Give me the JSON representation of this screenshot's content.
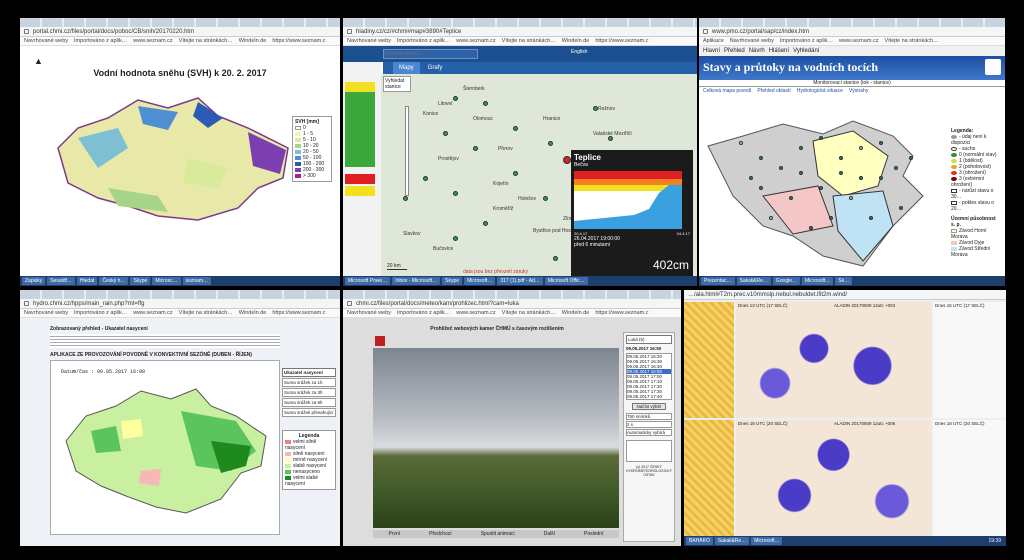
{
  "panels": [
    {
      "url": "portal.chmi.cz/files/portal/docs/poboc/CB/snih/20170220.htm",
      "bookmarks": [
        "Navrhované weby",
        "Importováno z aplik…",
        "www.seznam.cz",
        "Vítejte na stránkách…",
        "Windeln.de",
        "https://www.seznam.c"
      ],
      "title": "Vodní hodnota sněhu (SVH) k 20. 2. 2017",
      "legend_title": "SVH [mm]",
      "legend": [
        "0",
        "1 - 5",
        "5 - 10",
        "10 - 20",
        "20 - 50",
        "50 - 100",
        "100 - 200",
        "200 - 300",
        "> 300"
      ],
      "legend_colors": [
        "#ffffff",
        "#f6f2b0",
        "#d9eb9a",
        "#a8d489",
        "#7fbfd4",
        "#4d8fd0",
        "#2c5bb5",
        "#7b3fb0",
        "#b01f8f"
      ],
      "taskbar": [
        "Zapisky",
        "Sesaldf…",
        "Hledat",
        "Český h…",
        "Skype",
        "Microsc…",
        "seznam…"
      ]
    },
    {
      "url": "hladiny.cz/cz/#chmi#map#3890#Teplice",
      "bookmarks": [
        "Navrhované weby",
        "Importováno z aplik…",
        "www.seznam.cz",
        "Vítejte na stránkách…",
        "Windeln.de",
        "https://www.seznam.c"
      ],
      "search_placeholder": "Vyhledat stanici…",
      "english": "English",
      "tabs": [
        "Mapy",
        "Grafy"
      ],
      "stanice": "Vyhledat stanice",
      "places": [
        "Šternberk",
        "Olomouc",
        "Prostějov",
        "Přerov",
        "Kojetín",
        "Kroměříž",
        "Vsetín",
        "Holešov",
        "Bystřice pod Hostýnem",
        "Zlín",
        "Fryšták",
        "Luhačovice",
        "Bučovice",
        "Slavkov",
        "Konice",
        "Litovel",
        "Hranice",
        "Frenštát pod Radhoštěm",
        "Valašské Meziříčí",
        "Rožnov"
      ],
      "popup_station": "Teplice",
      "popup_river": "Bečva",
      "popup_date": "26.04.2017 19:00:00",
      "popup_age": "před 6 minutami",
      "popup_value": "402cm",
      "popup_dates": [
        "20.4.17",
        "24.4.17"
      ],
      "scale": "20 km",
      "footer": "data jsou bez převzetí záruky",
      "taskbar": [
        "Microsoft Powe…",
        "Inbox - Microsoft…",
        "Skype",
        "Microsoft…",
        "317 (1).pdf - Ad…",
        "Microsoft Offic…"
      ]
    },
    {
      "url": "www.pmo.cz/portal/sap/cz/index.htm",
      "bookmarks": [
        "Aplikace",
        "Navrhované weby",
        "Importováno z aplik…",
        "www.seznam.cz",
        "Vítejte na stránkách…"
      ],
      "title": "Stavy a průtoky na vodních tocích",
      "subtitle": "Monitorovací stanice (tok - stanice)",
      "nav": [
        "Celková mapa povodí",
        "Přehled oblastí",
        "Hydrologická situace",
        "Výstrahy"
      ],
      "nav2": [
        "Hlavní",
        "Přehled",
        "Návrh",
        "Hlášení",
        "Vyhledání"
      ],
      "legend_title": "Legenda:",
      "legend": [
        "- údaj není k dispozici",
        "- sucho",
        "0 (normální stav)",
        "1 (bdělost)",
        "2 (pohotovost)",
        "3 (ohrožení)",
        "3 (extrémní ohrožení)",
        "- nárůst stavu o 30…",
        "- pokles stavu o 20…"
      ],
      "legend_colors": [
        "#999999",
        "#ffffff",
        "#2e8b2e",
        "#c8e04a",
        "#f0a020",
        "#e03020",
        "#800000",
        "#ffffff",
        "#ffffff"
      ],
      "legend2_title": "Územní působnost s. p.",
      "legend2": [
        "Závod Horní Morava",
        "Závod Dyje",
        "Závod Střední Morava"
      ],
      "legend2_colors": [
        "#ffffc0",
        "#f5c6c6",
        "#bfe3f5"
      ],
      "taskbar": [
        "Prezentac…",
        "Sakali&Re…",
        "Google…",
        "Microsoft…",
        "Sk…"
      ]
    },
    {
      "url": "hydro.chmi.cz/hpps/main_rain.php?mt=ffg",
      "bookmarks": [
        "Navrhované weby",
        "Importováno z aplik…",
        "www.seznam.cz",
        "Vítejte na stránkách…",
        "Windeln.de",
        "https://www.seznam.c"
      ],
      "section": "Zobrazovaný přehled - Ukazatel nasycení",
      "title": "APLIKACE ZE PROVOZOVÁNÍ POVODNĚ V KONVEKTIVNÍ SEZÓNĚ (DUBEN - ŘÍJEN)",
      "datum": "Datum/čas : 09.05.2017 16:00",
      "buttons": [
        "Ukazatel nasycení",
        "Suma srážek za 1h",
        "Suma srážek za 3h",
        "Suma srážek za 6h",
        "Suma srážek přesahující"
      ],
      "legend_title": "Legenda",
      "legend": [
        "velmi silně nasycení",
        "silně nasycení",
        "mírně nasycení",
        "slabě nasycení",
        "nenasyceno",
        "velmi slabé nasycení"
      ],
      "legend_colors": [
        "#f08080",
        "#f7b7b7",
        "#ffffa0",
        "#c8f0a0",
        "#5cc45c",
        "#1e8a1e"
      ]
    },
    {
      "url": "chmi.cz/files/portal/docs/meteo/kam/prohlizec.html?cam=luka",
      "bookmarks": [
        "Navrhované weby",
        "Importováno z aplik…",
        "www.seznam.cz",
        "Vítejte na stránkách…",
        "Windeln.de",
        "https://www.seznam.c"
      ],
      "header": "Prohlížeč webových kamer ČHMÚ s časovým rozlišením",
      "station": "Luká (5)",
      "timestamp": "09.05.2017 16:50",
      "times": [
        "09.05.2017 16:20",
        "09.05.2017 16:30",
        "09.05.2017 16:40",
        "09.05.2017 16:50",
        "09.05.2017 17:00",
        "09.05.2017 17:10",
        "09.05.2017 17:20",
        "09.05.2017 17:30",
        "09.05.2017 17:40"
      ],
      "load_btn": "Načíst výběr",
      "options": [
        "750 snímků",
        "2 s",
        "Automaticky vybírá"
      ],
      "nav": [
        "První",
        "Předchozí",
        "Spustit animaci",
        "Další",
        "Poslední"
      ],
      "foot": "(c) 2017 ČESKÝ HYDROMETEOROLOGICKÝ ÚSTAV"
    },
    {
      "url": "…/ala.html#T2m.prec.v10mmslp.nebul.nebuldet.lfit2m.wind/",
      "labels": [
        "Dnes 13 UTC (17 SELČ)",
        "ALADIN 20170509 12utc +004",
        "Dnes 15 UTC (17 SELČ)",
        "Dnes 18 UTC (20 SELČ)",
        "ALADIN 20170509 12utc +006",
        "Dnes 18 UTC (20 SELČ)"
      ],
      "taskbar": [
        "BAHAKO",
        "Sakali&Re…",
        "Microsoft…"
      ],
      "clock": "19:39"
    }
  ]
}
